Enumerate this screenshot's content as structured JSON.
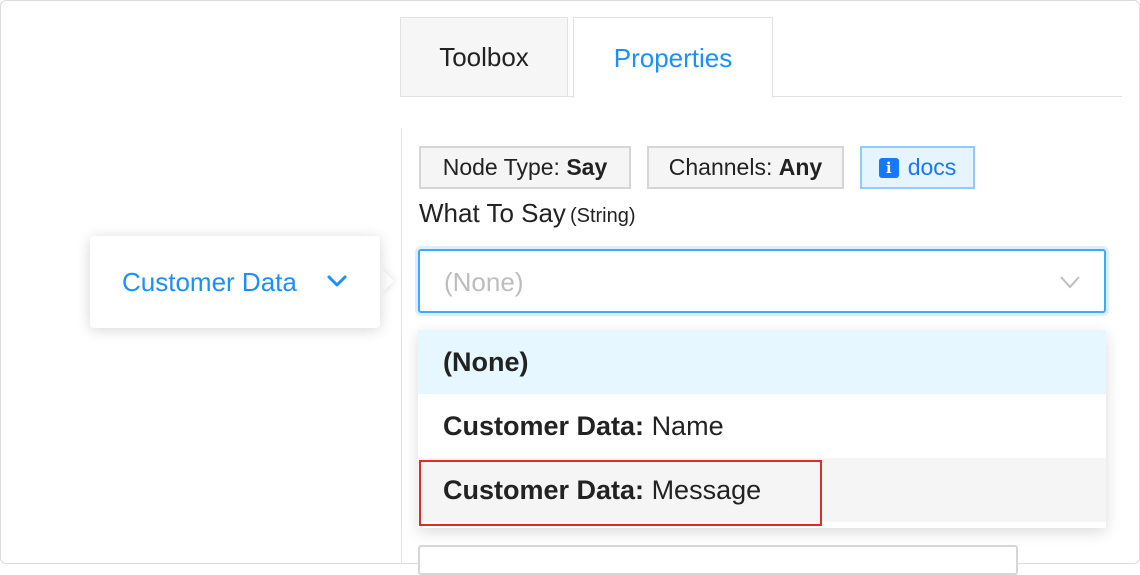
{
  "tabs": {
    "toolbox": "Toolbox",
    "properties": "Properties"
  },
  "tags": {
    "node_type_label": "Node Type:",
    "node_type_value": "Say",
    "channels_label": "Channels:",
    "channels_value": "Any",
    "docs_icon": "i",
    "docs_label": "docs"
  },
  "field": {
    "label": "What To Say",
    "type": "(String)"
  },
  "select": {
    "placeholder": "(None)",
    "arrow_icon": "chevron-down-icon"
  },
  "dropdown": {
    "options": [
      {
        "prefix": "(None)",
        "suffix": ""
      },
      {
        "prefix": "Customer Data:",
        "suffix": "Name"
      },
      {
        "prefix": "Customer Data:",
        "suffix": "Message"
      }
    ]
  },
  "popover": {
    "label": "Customer Data",
    "chevron_icon": "chevron-down-icon"
  },
  "colors": {
    "accent": "#1890ff",
    "selected_option_bg": "#e6f7ff",
    "highlight_border": "#d93025",
    "docs_bg": "#e6f4ff"
  }
}
